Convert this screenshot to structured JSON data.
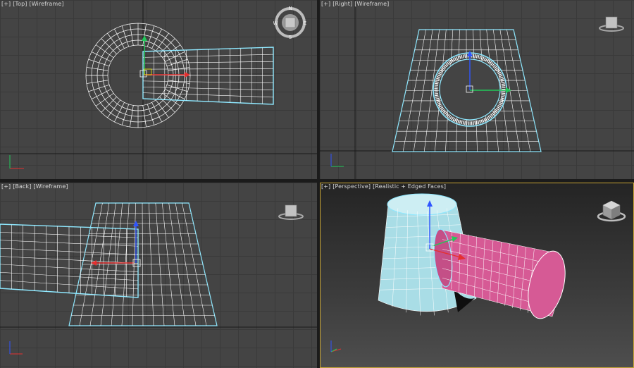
{
  "viewports": {
    "top": {
      "plus": "[+]",
      "view": "[Top]",
      "shading": "[Wireframe]"
    },
    "right": {
      "plus": "[+]",
      "view": "[Right]",
      "shading": "[Wireframe]"
    },
    "back": {
      "plus": "[+]",
      "view": "[Back]",
      "shading": "[Wireframe]"
    },
    "perspective": {
      "plus": "[+]",
      "view": "[Perspective]",
      "shading": "[Realistic + Edged Faces]"
    }
  },
  "compass": {
    "n": "N",
    "s": "S",
    "e": "E",
    "w": "W"
  },
  "colors": {
    "viewport_bg": "#444444",
    "grid": "#3a3a3a",
    "wire_white": "#ffffff",
    "wire_selected": "#8ee8ff",
    "cone_fill": "#a9dde6",
    "cylinder_fill": "#d65a95",
    "active_border": "#c9a635",
    "axis_x": "#e53030",
    "axis_y": "#22c85a",
    "axis_z": "#2f55ff"
  },
  "icons": [
    "view-cube-icon",
    "compass-icon",
    "axis-tripod-icon",
    "transform-gizmo-icon"
  ]
}
